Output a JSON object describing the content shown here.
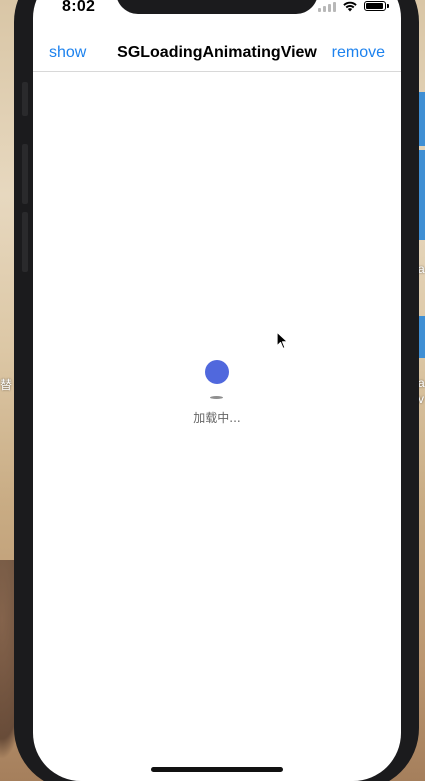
{
  "status_bar": {
    "time": "8:02",
    "wifi_icon": "wifi-icon",
    "battery_icon": "battery-icon",
    "signal_icon": "signal-icon"
  },
  "navbar": {
    "left_label": "show",
    "title": "SGLoadingAnimatingView",
    "right_label": "remove"
  },
  "loader": {
    "text": "加载中...",
    "ball_color": "#5068DD"
  },
  "desktop": {
    "left_text": "替",
    "right_texts": [
      "a",
      "a",
      "v"
    ]
  },
  "colors": {
    "accent": "#1D82EE"
  }
}
